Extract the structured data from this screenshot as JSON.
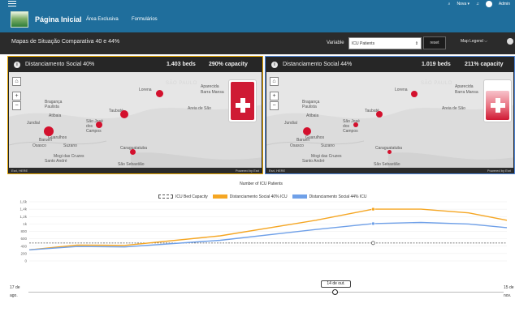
{
  "nav": {
    "title": "Página Inicial",
    "links": [
      "Área Exclusiva",
      "Formulários"
    ],
    "right": {
      "language": "Nova ▾",
      "user": "Admin"
    }
  },
  "toolbar": {
    "title": "Mapas de Situação Comparativa 40 e 44%",
    "variable_label": "Variable",
    "variable_value": "ICU Patients",
    "reset_label": "reset",
    "map_legend_label": "Map Legend ⌵"
  },
  "panels": [
    {
      "name": "Distanciamento Social 40%",
      "beds": "1.403 beds",
      "capacity": "290% capacity",
      "gauge_fill": 1.0,
      "attribution_left": "Esri, HERE",
      "attribution_right": "Powered by Esri"
    },
    {
      "name": "Distanciamento Social 44%",
      "beds": "1.019 beds",
      "capacity": "211% capacity",
      "gauge_fill": 0.78,
      "attribution_left": "Esri, HERE",
      "attribution_right": "Powered by Esri"
    }
  ],
  "map_places": [
    "Lorena",
    "Aparecida",
    "Barra Mansa",
    "SÃO PAULO",
    "Bragança Paulista",
    "Atibaia",
    "Taubaté",
    "Areia de São",
    "Jundiaí",
    "São José dos Campos",
    "Barueri",
    "Guarulhos",
    "Osasco",
    "Suzano",
    "Caraguatatuba",
    "Mogi das Cruzes",
    "Santo André",
    "São Sebastião"
  ],
  "chart_data": {
    "type": "line",
    "title": "Number of ICU Patients",
    "series": [
      {
        "name": "ICU Bed Capacity",
        "color": "#555555",
        "style": "dashed"
      },
      {
        "name": "Distanciamento Social 40% ICU",
        "color": "#f5a623"
      },
      {
        "name": "Distanciamento Social 44% ICU",
        "color": "#6fa0e8"
      }
    ],
    "y_ticks": [
      "1,6k",
      "1,4k",
      "1,2k",
      "1k",
      "800",
      "600",
      "400",
      "200",
      "0"
    ],
    "ylim": [
      0,
      1600
    ],
    "x_ticks": [
      "",
      "",
      "",
      ""
    ],
    "capacity_value": 485,
    "points_40": [
      [
        0,
        300
      ],
      [
        10,
        430
      ],
      [
        20,
        420
      ],
      [
        40,
        680
      ],
      [
        60,
        1100
      ],
      [
        72,
        1400
      ],
      [
        82,
        1400
      ],
      [
        92,
        1300
      ],
      [
        100,
        1100
      ]
    ],
    "points_44": [
      [
        0,
        300
      ],
      [
        10,
        390
      ],
      [
        20,
        380
      ],
      [
        40,
        560
      ],
      [
        60,
        850
      ],
      [
        72,
        1010
      ],
      [
        82,
        1040
      ],
      [
        92,
        1000
      ],
      [
        100,
        900
      ]
    ],
    "marker_x": 72,
    "scroll": {
      "start": "17 de ago.",
      "current": "14 de out.",
      "end": "15 de nov."
    }
  }
}
